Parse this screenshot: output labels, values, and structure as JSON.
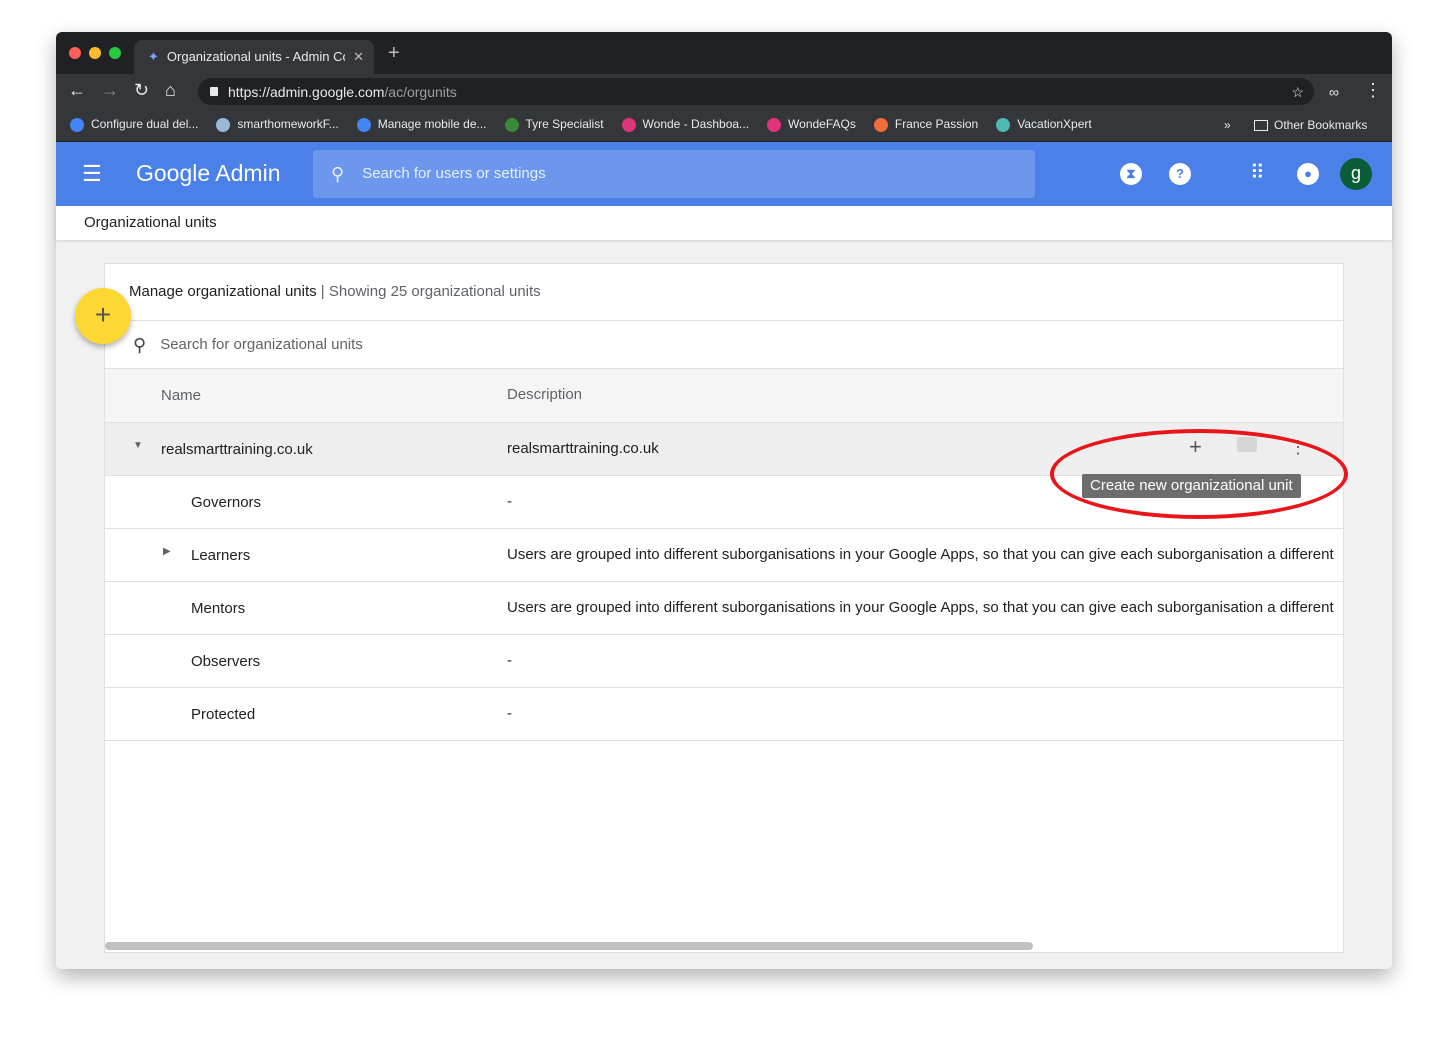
{
  "browser": {
    "tab_title": "Organizational units - Admin Console",
    "url_host": "https://admin.google.com",
    "url_path": "/ac/orgunits",
    "bookmarks": [
      {
        "label": "Configure dual del...",
        "color": "#4285f4"
      },
      {
        "label": "smarthomeworkF...",
        "color": "#9ab8d8"
      },
      {
        "label": "Manage mobile de...",
        "color": "#4285f4"
      },
      {
        "label": "Tyre Specialist",
        "color": "#3a8a3a"
      },
      {
        "label": "Wonde - Dashboa...",
        "color": "#e0347a"
      },
      {
        "label": "WondeFAQs",
        "color": "#e0347a"
      },
      {
        "label": "France Passion",
        "color": "#f26b3a"
      },
      {
        "label": "VacationXpert",
        "color": "#4fb8b0"
      }
    ],
    "more": "»",
    "other_bookmarks": "Other Bookmarks"
  },
  "header": {
    "logo": "Google Admin",
    "search_placeholder": "Search for users or settings",
    "avatar": "g"
  },
  "breadcrumb": "Organizational units",
  "card": {
    "title": "Manage organizational units",
    "subtitle": "Showing 25 organizational units",
    "search_placeholder": "Search for organizational units",
    "columns": [
      "Name",
      "Description"
    ],
    "rows": [
      {
        "name": "realsmarttraining.co.uk",
        "description": "realsmarttraining.co.uk",
        "expander": "▼",
        "level": 0
      },
      {
        "name": "Governors",
        "description": "-",
        "expander": "",
        "level": 1
      },
      {
        "name": "Learners",
        "description": "Users are grouped into different suborganisations in your Google Apps, so that you can give each suborganisation a different",
        "expander": "▶",
        "level": 1
      },
      {
        "name": "Mentors",
        "description": "Users are grouped into different suborganisations in your Google Apps, so that you can give each suborganisation a different",
        "expander": "",
        "level": 1
      },
      {
        "name": "Observers",
        "description": "-",
        "expander": "",
        "level": 1
      },
      {
        "name": "Protected",
        "description": "-",
        "expander": "",
        "level": 1
      }
    ]
  },
  "tooltip": "Create new organizational unit"
}
